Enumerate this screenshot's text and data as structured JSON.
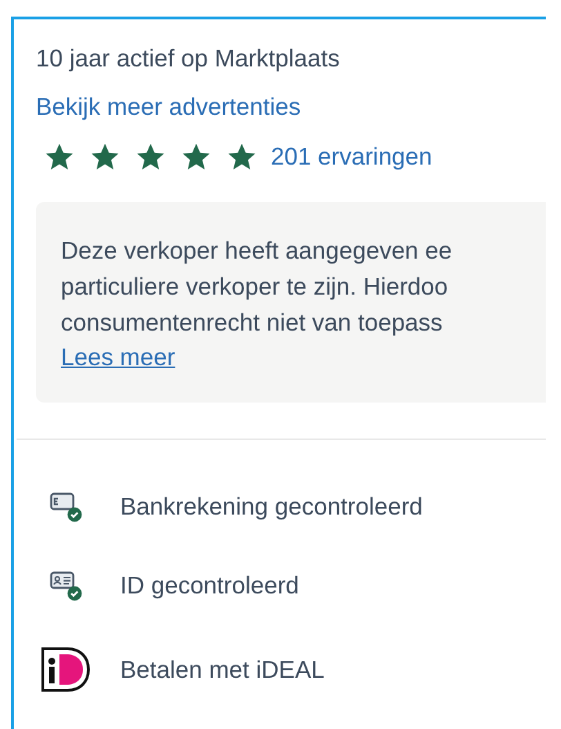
{
  "seller": {
    "active_since": "10 jaar actief op Marktplaats",
    "more_link": "Bekijk meer advertenties",
    "rating": {
      "stars": 5,
      "reviews_link": "201 ervaringen"
    }
  },
  "notice": {
    "lines": [
      "Deze verkoper heeft aangegeven ee",
      "particuliere verkoper te zijn. Hierdoo",
      "consumentenrecht niet van toepass"
    ],
    "link": "Lees meer"
  },
  "badges": [
    {
      "kind": "bank",
      "label": "Bankrekening gecontroleerd"
    },
    {
      "kind": "id",
      "label": "ID gecontroleerd"
    },
    {
      "kind": "ideal",
      "label": "Betalen met iDEAL"
    }
  ]
}
